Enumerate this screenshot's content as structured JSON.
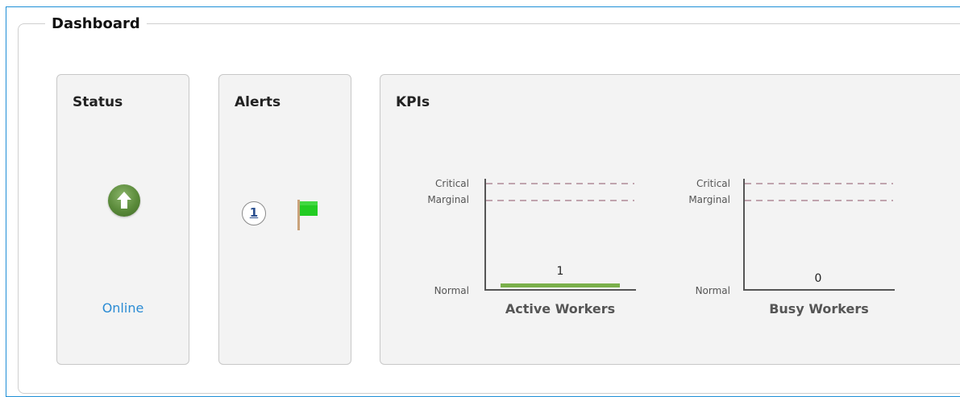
{
  "dashboard": {
    "title": "Dashboard"
  },
  "status_panel": {
    "title": "Status",
    "state": "Online",
    "icon": "arrow-up-circle-icon",
    "icon_color": "#5a8a3a"
  },
  "alerts_panel": {
    "title": "Alerts",
    "count": "1",
    "icon": "flag-icon",
    "flag_color": "#22cc22"
  },
  "kpis_panel": {
    "title": "KPIs",
    "gauges": [
      {
        "name": "Active Workers",
        "value": "1",
        "level_labels": [
          "Critical",
          "Marginal",
          "Normal"
        ],
        "bar_color": "#7ab04a"
      },
      {
        "name": "Busy Workers",
        "value": "0",
        "level_labels": [
          "Critical",
          "Marginal",
          "Normal"
        ],
        "bar_color": "#7ab04a"
      }
    ],
    "threshold_line_color": "#b08a98"
  }
}
